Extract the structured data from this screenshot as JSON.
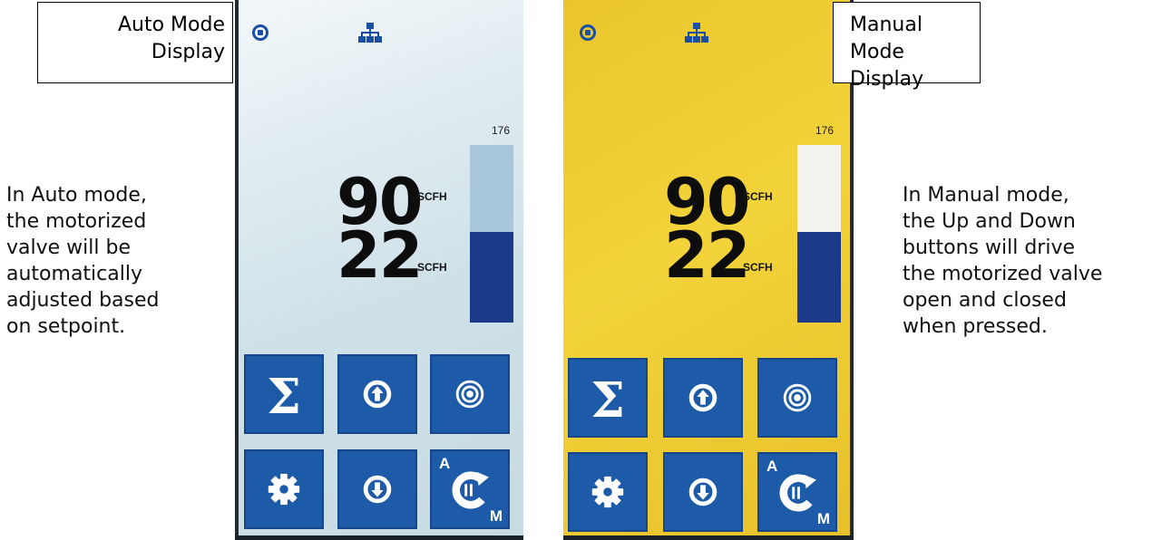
{
  "callouts": {
    "auto": {
      "line1": "Auto Mode",
      "line2": "Display"
    },
    "manual": {
      "line1": "Manual Mode",
      "line2": "Display"
    }
  },
  "descriptions": {
    "auto": [
      "In Auto mode,",
      "the motorized",
      "valve will be",
      "automatically",
      "adjusted based",
      "on setpoint."
    ],
    "manual": [
      "In Manual mode,",
      "the Up and Down",
      "buttons will drive",
      "the motorized valve",
      "open and closed",
      "when pressed."
    ]
  },
  "devices": {
    "auto": {
      "mode": "auto",
      "background_color": "#cfe1e8",
      "bar_max": "176",
      "flow": "90",
      "flow_unit": "SCFH",
      "setpoint": "22",
      "setpoint_unit": "SCFH",
      "bar_fill_fraction": 0.51,
      "bar_track_color": "#a9c7da"
    },
    "manual": {
      "mode": "manual",
      "background_color": "#f0cf33",
      "bar_max": "176",
      "flow": "90",
      "flow_unit": "SCFH",
      "setpoint": "22",
      "setpoint_unit": "SCFH",
      "bar_fill_fraction": 0.51,
      "bar_track_color": "#f4f2ec"
    }
  },
  "buttons": {
    "totalizer": {
      "icon": "sigma-icon"
    },
    "up": {
      "icon": "arrow-up-circle-icon"
    },
    "setpoint": {
      "icon": "target-icon"
    },
    "settings": {
      "icon": "gear-icon"
    },
    "down": {
      "icon": "arrow-down-circle-icon"
    },
    "mode": {
      "icon": "mode-toggle-icon",
      "label_a": "A",
      "label_m": "M"
    }
  },
  "colors": {
    "button_blue": "#1d5aa8",
    "bar_fill": "#1b3a8a",
    "status_blue": "#1c4fa3"
  }
}
